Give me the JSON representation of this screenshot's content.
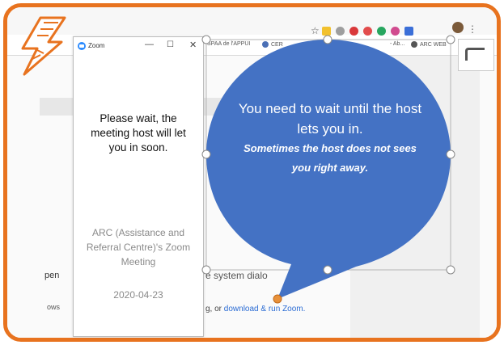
{
  "zoom_window": {
    "title": "Zoom",
    "minimize_label": "—",
    "maximize_label": "☐",
    "close_label": "✕",
    "wait_message": "Please wait, the meeting host will let you in soon.",
    "meeting_name": "ARC (Assistance and Referral Centre)'s Zoom Meeting",
    "meeting_date": "2020-04-23"
  },
  "bubble": {
    "main_text": "You need to wait until the host lets you in.",
    "sub_text": "Sometimes the host does not sees you right away.",
    "fill_color": "#4472c4"
  },
  "browser": {
    "bookmarks": [
      "SPAA de l'APPUI",
      "CER",
      "- Ab...",
      "ARC WEB"
    ],
    "side_text_open": "pen",
    "side_text_ows": "ows",
    "dialog_text": "e system dialo",
    "download_prefix": "g, or ",
    "download_link": "download & run Zoom."
  },
  "colors": {
    "frame": "#e8731f",
    "handle": "#e8913a"
  },
  "icons": [
    "lightning-logo-icon",
    "zoom-logo-icon",
    "star-icon",
    "menu-dots-icon",
    "document-icon"
  ]
}
